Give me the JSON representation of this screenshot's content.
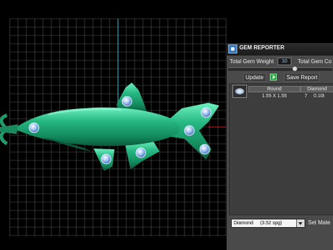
{
  "panel": {
    "title": "GEM REPORTER",
    "total_weight_label": "Total Gem Weight",
    "total_weight_value": "10",
    "total_count_label": "Total Gem Co",
    "update_label": "Update",
    "save_report_label": "Save Report",
    "table": {
      "headers": [
        "Round",
        "Diamond"
      ],
      "row": {
        "size": "1.55 X 1.55",
        "count": "7",
        "weight": "0.10t"
      }
    },
    "material_select": {
      "value": "Diamond",
      "sg": "(3.52 spg)"
    },
    "set_material_label": "Set Mate"
  },
  "colors": {
    "model": "#1f9c6a",
    "gem": "#7fb0ea",
    "grid": "#5a5a5a",
    "panel": "#4a4a4a",
    "axis_cyan": "#2fc8d8",
    "axis_red": "#d11a1a"
  },
  "icons": {
    "panel_logo": "gem-reporter-logo-icon",
    "go": "play-arrow-icon",
    "gem_thumb": "round-gem-icon",
    "dropdown": "chevron-down-icon"
  }
}
